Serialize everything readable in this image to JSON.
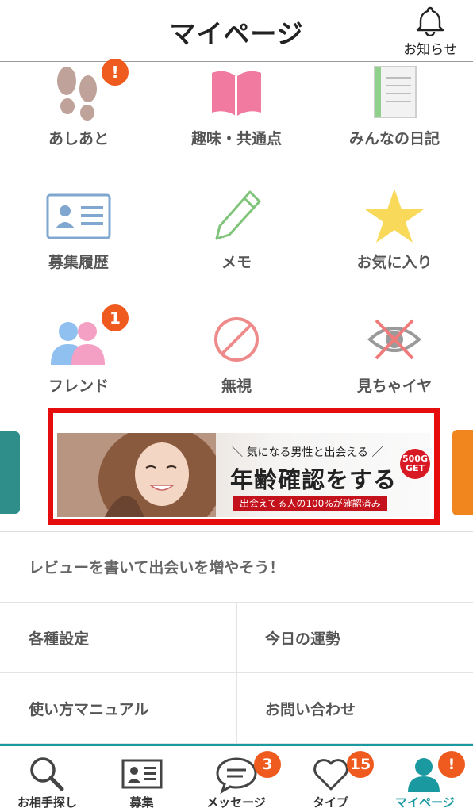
{
  "header": {
    "title": "マイページ",
    "notice_label": "お知らせ"
  },
  "grid": [
    {
      "label": "あしあと",
      "icon": "footprints-icon",
      "badge": "!"
    },
    {
      "label": "趣味・共通点",
      "icon": "open-book-icon",
      "badge": null
    },
    {
      "label": "みんなの日記",
      "icon": "notebook-icon",
      "badge": null
    },
    {
      "label": "募集履歴",
      "icon": "id-card-icon",
      "badge": null
    },
    {
      "label": "メモ",
      "icon": "pencil-icon",
      "badge": null
    },
    {
      "label": "お気に入り",
      "icon": "star-icon",
      "badge": null
    },
    {
      "label": "フレンド",
      "icon": "friends-icon",
      "badge": "1"
    },
    {
      "label": "無視",
      "icon": "prohibited-icon",
      "badge": null
    },
    {
      "label": "見ちゃイヤ",
      "icon": "crossed-eye-icon",
      "badge": null
    }
  ],
  "banner": {
    "tagline": "＼ 気になる男性と出会える ／",
    "main": "年齢確認をする",
    "sub": "出会えてる人の100%が確認済み",
    "gold_amount": "500G",
    "gold_label": "GET"
  },
  "review_prompt": "レビューを書いて出会いを増やそう！",
  "menu": [
    {
      "label": "各種設定"
    },
    {
      "label": "今日の運勢"
    },
    {
      "label": "使い方マニュアル"
    },
    {
      "label": "お問い合わせ"
    }
  ],
  "tabs": [
    {
      "label": "お相手探し",
      "icon": "search-icon",
      "badge": null
    },
    {
      "label": "募集",
      "icon": "id-card-icon",
      "badge": null
    },
    {
      "label": "メッセージ",
      "icon": "chat-bubble-icon",
      "badge": "3"
    },
    {
      "label": "タイプ",
      "icon": "heart-icon",
      "badge": "15"
    },
    {
      "label": "マイページ",
      "icon": "person-icon",
      "badge": "!",
      "active": true
    }
  ],
  "colors": {
    "accent": "#1a9aa0",
    "badge": "#ef5a1e",
    "banner_border": "#e50d0d"
  }
}
